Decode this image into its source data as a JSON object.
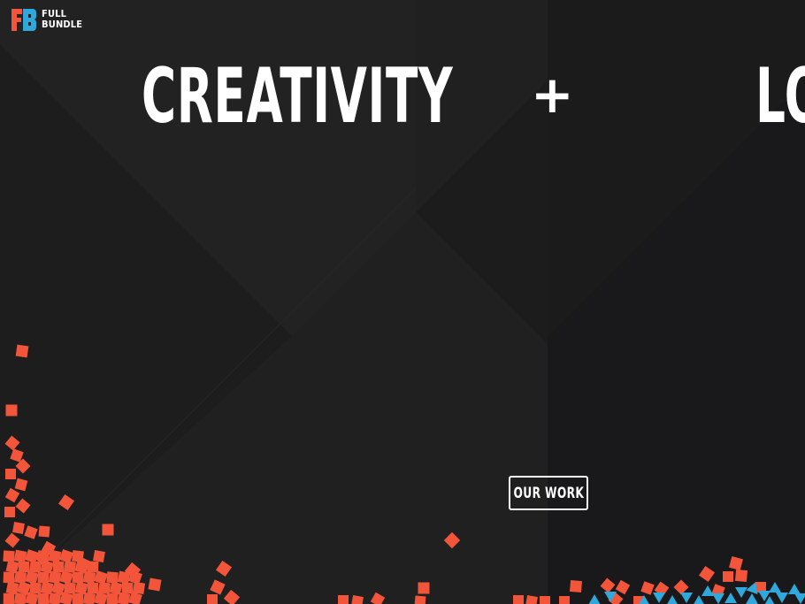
{
  "brand": {
    "logo_line1": "FULL",
    "logo_line2": "BUNDLE",
    "colors": {
      "orange": "#f2553a",
      "blue": "#2fa8dc",
      "background": "#1f1f20"
    }
  },
  "hero": {
    "word_left": "CREATIVITY",
    "operator": "+",
    "word_right": "LO"
  },
  "cta": {
    "label": "OUR WORK"
  }
}
